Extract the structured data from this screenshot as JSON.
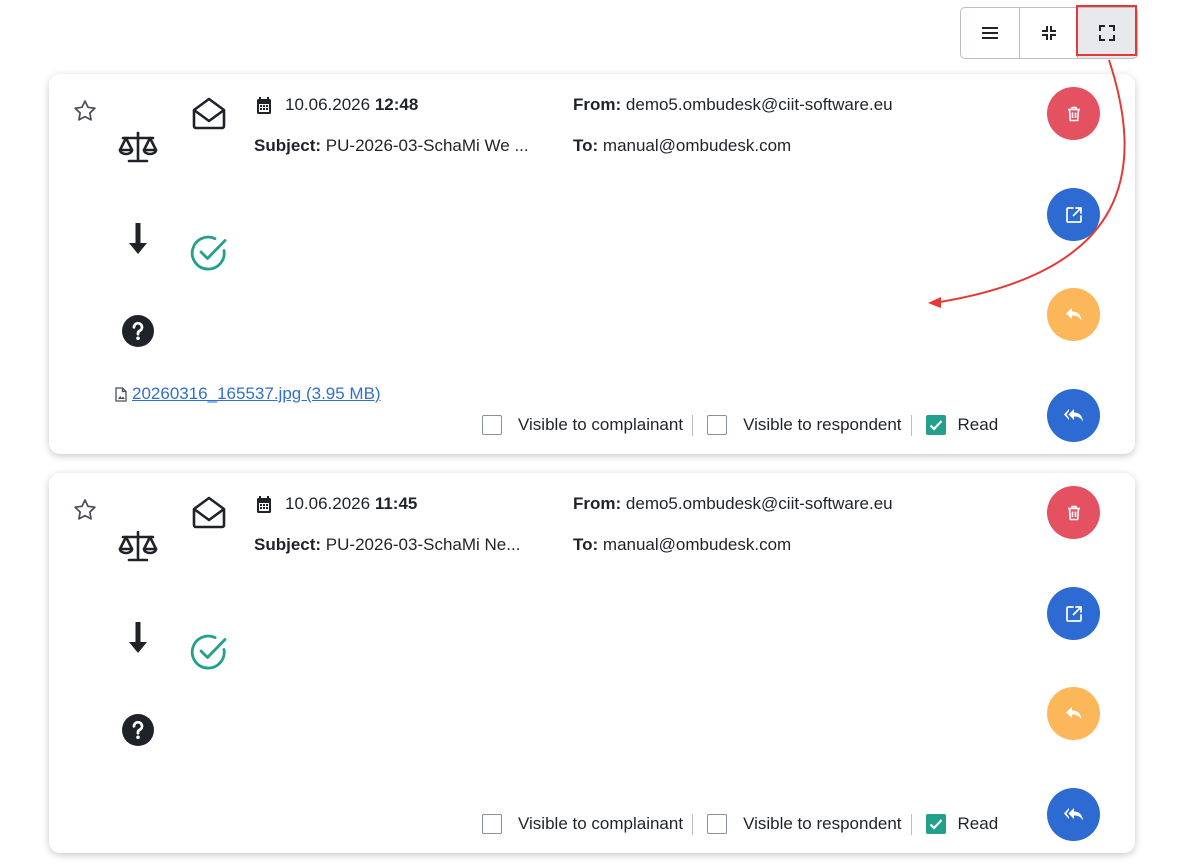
{
  "toolbar": {
    "buttons": [
      {
        "name": "list-view",
        "icon": "list-icon",
        "active": false
      },
      {
        "name": "compact-view",
        "icon": "collapse-icon",
        "active": false
      },
      {
        "name": "expanded-view",
        "icon": "expand-icon",
        "active": true
      }
    ]
  },
  "colors": {
    "delete": "#e45262",
    "open": "#2d6bd3",
    "reply": "#fcb75b",
    "reply_all": "#2d6bd3",
    "check_teal": "#23a08d",
    "link": "#2f6fd0",
    "annotation_red": "#e53935"
  },
  "messages": [
    {
      "date": "10.06.2026",
      "time": "12:48",
      "subject_label": "Subject:",
      "subject": "PU-2026-03-SchaMi We ...",
      "from_label": "From:",
      "from": "demo5.ombudesk@ciit-software.eu",
      "to_label": "To:",
      "to": "manual@ombudesk.com",
      "attachment": "20260316_165537.jpg (3.95 MB)",
      "flags": {
        "visible_to_complainant": {
          "label": "Visible to complainant",
          "checked": false
        },
        "visible_to_respondent": {
          "label": "Visible to respondent",
          "checked": false
        },
        "read": {
          "label": "Read",
          "checked": true
        }
      },
      "icons": [
        "star-icon",
        "envelope-open-icon",
        "scale-icon",
        "arrow-down-icon",
        "check-circle-icon",
        "question-circle-icon"
      ]
    },
    {
      "date": "10.06.2026",
      "time": "11:45",
      "subject_label": "Subject:",
      "subject": "PU-2026-03-SchaMi Ne...",
      "from_label": "From:",
      "from": "demo5.ombudesk@ciit-software.eu",
      "to_label": "To:",
      "to": "manual@ombudesk.com",
      "attachment": "",
      "flags": {
        "visible_to_complainant": {
          "label": "Visible to complainant",
          "checked": false
        },
        "visible_to_respondent": {
          "label": "Visible to respondent",
          "checked": false
        },
        "read": {
          "label": "Read",
          "checked": true
        }
      },
      "icons": [
        "star-icon",
        "envelope-open-icon",
        "scale-icon",
        "arrow-down-icon",
        "check-circle-icon",
        "question-circle-icon"
      ]
    }
  ]
}
